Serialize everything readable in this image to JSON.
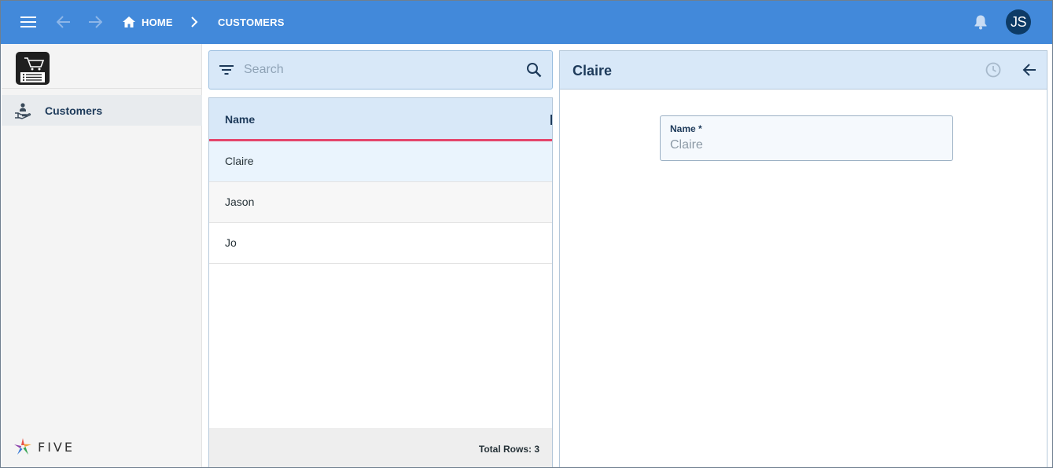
{
  "topbar": {
    "menu_icon": "hamburger-menu-icon",
    "back_icon": "arrow-left-icon",
    "forward_icon": "arrow-right-icon",
    "breadcrumb": [
      {
        "label": "HOME",
        "icon": "home-icon"
      },
      {
        "label": "CUSTOMERS"
      }
    ],
    "notification_icon": "bell-icon",
    "avatar_initials": "JS"
  },
  "sidebar": {
    "app_logo_icon": "shopping-cart-list-icon",
    "items": [
      {
        "label": "Customers",
        "icon": "hand-person-icon",
        "active": true
      }
    ],
    "brand_text": "FIVE"
  },
  "list": {
    "search_placeholder": "Search",
    "columns": [
      "Name"
    ],
    "rows": [
      {
        "name": "Claire",
        "selected": true
      },
      {
        "name": "Jason"
      },
      {
        "name": "Jo"
      }
    ],
    "footer": "Total Rows: 3"
  },
  "detail": {
    "title": "Claire",
    "fields": [
      {
        "label": "Name *",
        "value": "Claire"
      }
    ],
    "history_icon": "clock-icon",
    "back_icon": "arrow-left-icon"
  },
  "colors": {
    "topbar": "#4289da",
    "header_bg": "#d8e8f8",
    "sort_underline": "#e4456b",
    "selected_row": "#eaf4fd",
    "avatar": "#0d3b66"
  }
}
